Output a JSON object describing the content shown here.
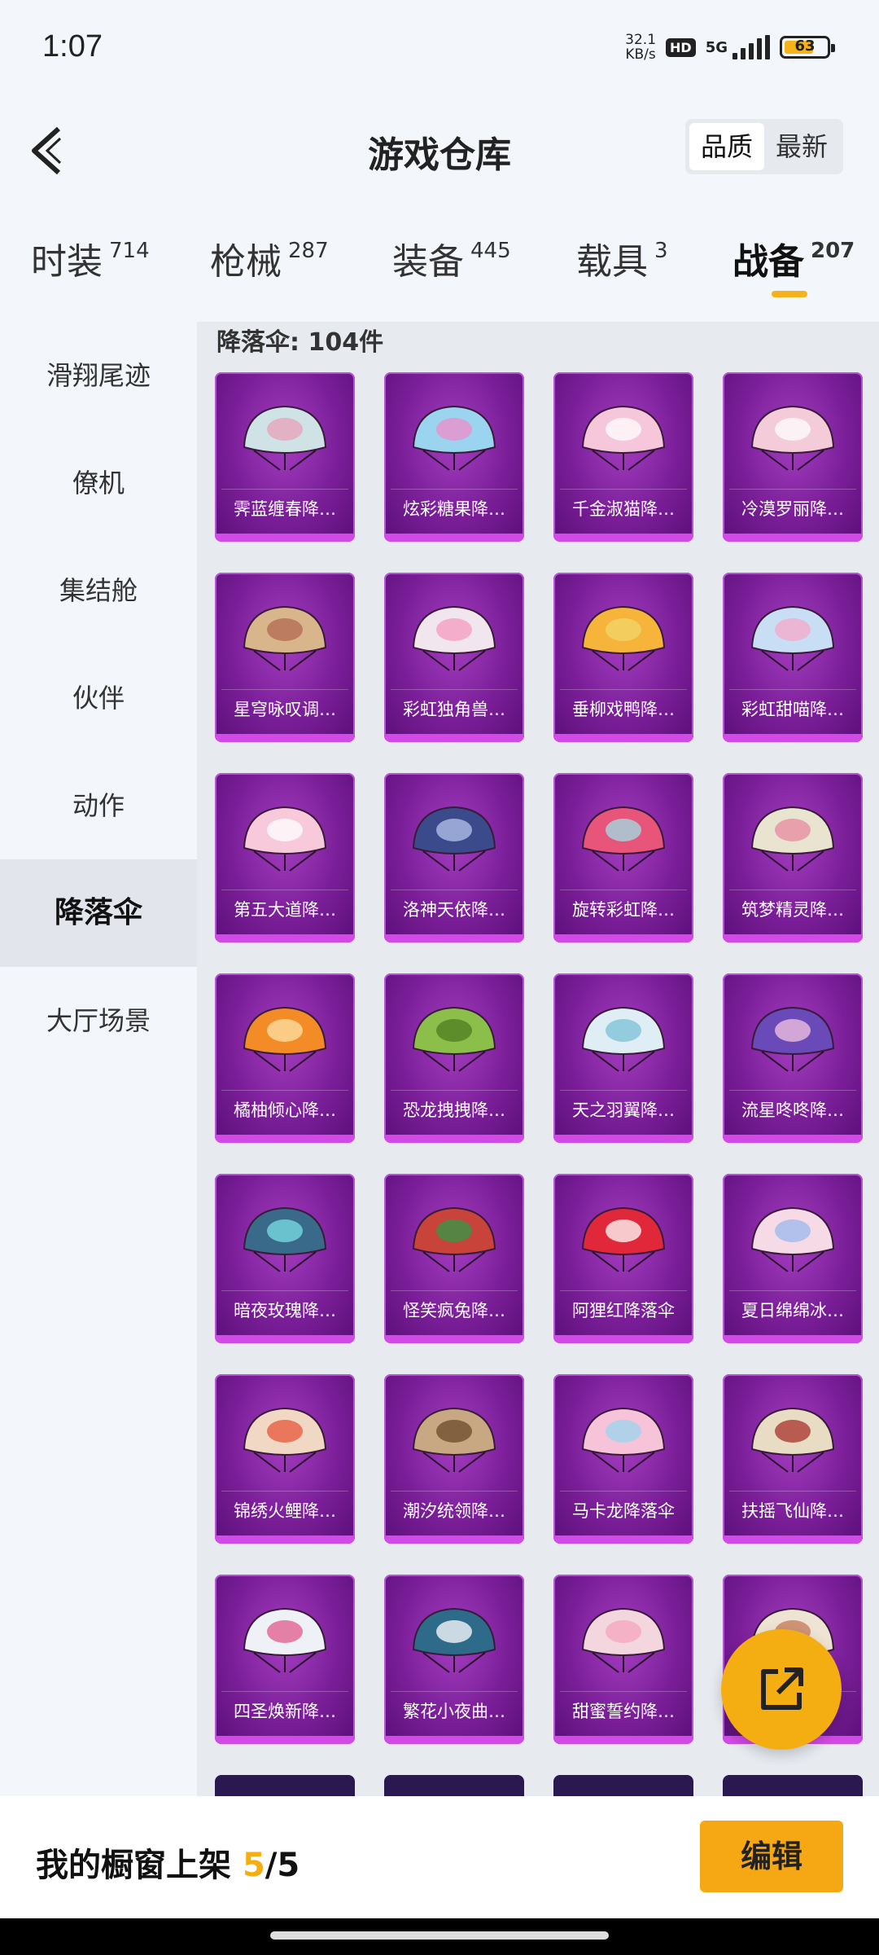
{
  "status": {
    "time": "1:07",
    "speed_value": "32.1",
    "speed_unit": "KB/s",
    "hd": "HD",
    "network": "5G",
    "battery": "63"
  },
  "header": {
    "title": "游戏仓库",
    "sort_quality": "品质",
    "sort_latest": "最新"
  },
  "tabs": [
    {
      "label": "时装",
      "count": "714"
    },
    {
      "label": "枪械",
      "count": "287"
    },
    {
      "label": "装备",
      "count": "445"
    },
    {
      "label": "载具",
      "count": "3"
    },
    {
      "label": "战备",
      "count": "207"
    }
  ],
  "sidebar": {
    "items": [
      {
        "label": "滑翔尾迹"
      },
      {
        "label": "僚机"
      },
      {
        "label": "集结舱"
      },
      {
        "label": "伙伴"
      },
      {
        "label": "动作"
      },
      {
        "label": "降落伞"
      },
      {
        "label": "大厅场景"
      }
    ]
  },
  "content": {
    "count_label": "降落伞: 104件",
    "items": [
      {
        "name": "霁蓝缠春降…",
        "color": "#cfe3e6",
        "accent": "#e8a0b8"
      },
      {
        "name": "炫彩糖果降…",
        "color": "#9ad4ef",
        "accent": "#f08cc8"
      },
      {
        "name": "千金淑猫降…",
        "color": "#f6c6da",
        "accent": "#ffffff"
      },
      {
        "name": "冷漠罗丽降…",
        "color": "#f4cbd8",
        "accent": "#ffffff"
      },
      {
        "name": "星穹咏叹调…",
        "color": "#d9b58c",
        "accent": "#b06a50"
      },
      {
        "name": "彩虹独角兽…",
        "color": "#f2e6ee",
        "accent": "#f59ac0"
      },
      {
        "name": "垂柳戏鸭降…",
        "color": "#f6b43a",
        "accent": "#f2d56a"
      },
      {
        "name": "彩虹甜喵降…",
        "color": "#c7def4",
        "accent": "#f6a8c8"
      },
      {
        "name": "第五大道降…",
        "color": "#f7c9da",
        "accent": "#ffffff"
      },
      {
        "name": "洛神天依降…",
        "color": "#3a4a8a",
        "accent": "#b7c4ee"
      },
      {
        "name": "旋转彩虹降…",
        "color": "#e7557a",
        "accent": "#9fe0e6"
      },
      {
        "name": "筑梦精灵降…",
        "color": "#e9e4cf",
        "accent": "#e78aa0"
      },
      {
        "name": "橘柚倾心降…",
        "color": "#f38b26",
        "accent": "#fde2a6"
      },
      {
        "name": "恐龙拽拽降…",
        "color": "#8cbf4a",
        "accent": "#4e7b22"
      },
      {
        "name": "天之羽翼降…",
        "color": "#dfeef4",
        "accent": "#7ac0d8"
      },
      {
        "name": "流星咚咚降…",
        "color": "#6a4ab8",
        "accent": "#f6c6e0"
      },
      {
        "name": "暗夜玫瑰降…",
        "color": "#3a6a8a",
        "accent": "#7be0e6"
      },
      {
        "name": "怪笑疯兔降…",
        "color": "#c8443a",
        "accent": "#2f9a4a"
      },
      {
        "name": "阿狸红降落伞",
        "color": "#e0283a",
        "accent": "#ffffff"
      },
      {
        "name": "夏日绵绵冰…",
        "color": "#f6dbe6",
        "accent": "#9ab8ee"
      },
      {
        "name": "锦绣火鲤降…",
        "color": "#f0d8c4",
        "accent": "#e8553a"
      },
      {
        "name": "潮汐统领降…",
        "color": "#c8a882",
        "accent": "#6a4a2a"
      },
      {
        "name": "马卡龙降落伞",
        "color": "#f6c3d8",
        "accent": "#9ad6ef"
      },
      {
        "name": "扶摇飞仙降…",
        "color": "#e8dcc4",
        "accent": "#a8302a"
      },
      {
        "name": "四圣焕新降…",
        "color": "#eef2f6",
        "accent": "#e05a8a"
      },
      {
        "name": "繁花小夜曲…",
        "color": "#2e6a8a",
        "accent": "#ffffff"
      },
      {
        "name": "甜蜜誓约降…",
        "color": "#f4d6de",
        "accent": "#f6a6be"
      },
      {
        "name": "",
        "color": "#efe4d4",
        "accent": "#c47a5a"
      }
    ]
  },
  "bottom": {
    "label": "我的橱窗上架",
    "current": "5",
    "sep": "/",
    "total": "5",
    "edit_label": "编辑"
  }
}
